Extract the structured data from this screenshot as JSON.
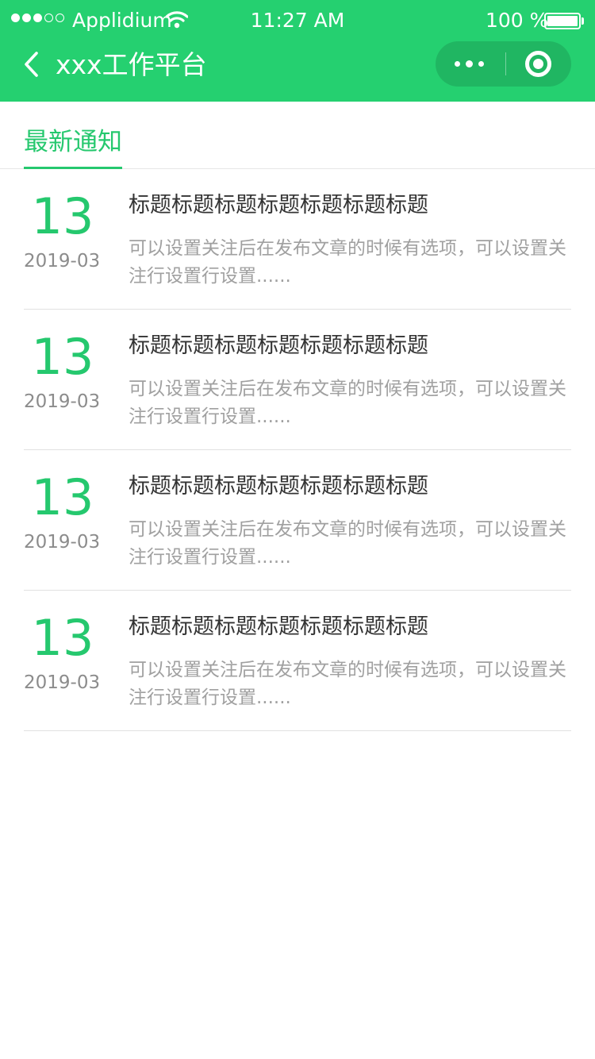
{
  "status_bar": {
    "carrier": "Applidium",
    "time": "11:27 AM",
    "battery": "100 %",
    "signal_dots_filled": 3,
    "signal_dots_total": 5
  },
  "nav": {
    "title": "xxx工作平台",
    "back_icon": "chevron-left-icon",
    "more_icon": "more-dots-icon",
    "close_icon": "target-close-icon"
  },
  "tabs": [
    {
      "label": "最新通知",
      "active": true
    }
  ],
  "notices": [
    {
      "day": "13",
      "year_month": "2019-03",
      "title": "标题标题标题标题标题标题标题",
      "desc": "可以设置关注后在发布文章的时候有选项，可以设置关注行设置行设置......"
    },
    {
      "day": "13",
      "year_month": "2019-03",
      "title": "标题标题标题标题标题标题标题",
      "desc": "可以设置关注后在发布文章的时候有选项，可以设置关注行设置行设置......"
    },
    {
      "day": "13",
      "year_month": "2019-03",
      "title": "标题标题标题标题标题标题标题",
      "desc": "可以设置关注后在发布文章的时候有选项，可以设置关注行设置行设置......"
    },
    {
      "day": "13",
      "year_month": "2019-03",
      "title": "标题标题标题标题标题标题标题",
      "desc": "可以设置关注后在发布文章的时候有选项，可以设置关注行设置行设置......"
    }
  ],
  "colors": {
    "brand": "#25d070",
    "accent": "#25c86e",
    "title_text": "#333333",
    "secondary_text": "#a0a0a0"
  }
}
